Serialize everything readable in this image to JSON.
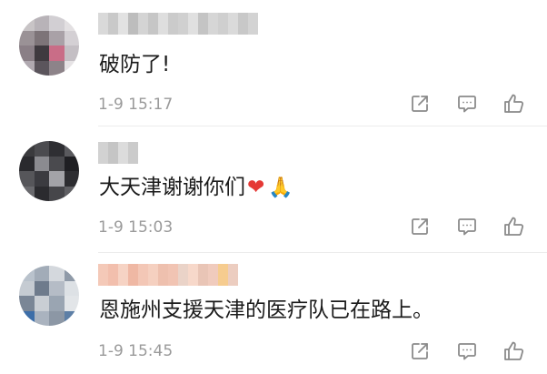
{
  "comments": [
    {
      "text": "破防了!",
      "time": "1-9 15:17",
      "avatar_pixels": [
        "#c8c4c6",
        "#b8b3b8",
        "#d2cfd3",
        "#e3e0e2",
        "#9a9296",
        "#7d7478",
        "#a9a1a7",
        "#d4d0d4",
        "#8a7f86",
        "#3f3a3f",
        "#c96d87",
        "#c4bfc4",
        "#b0a9b0",
        "#5b555c",
        "#8d8389",
        "#e6e3e5"
      ],
      "username_blocks": [
        "#d9d9d9",
        "#c9c9c9",
        "#e2e2e2",
        "#bdbdbd",
        "#d4d4d4",
        "#c6c6c6",
        "#dedede",
        "#cbcbcb",
        "#d0d0d0",
        "#e0e0e0",
        "#c4c4c4",
        "#d6d6d6",
        "#cfcfcf",
        "#dadada",
        "#c8c8c8",
        "#d3d3d3"
      ]
    },
    {
      "text": "大天津谢谢你们",
      "time": "1-9 15:03",
      "emoji_heart": "❤",
      "emoji_hands": "🙏",
      "avatar_pixels": [
        "#3a3a3d",
        "#4b4b4f",
        "#2f2f33",
        "#5a5a5e",
        "#2a2a2e",
        "#8b8b90",
        "#4a4a4e",
        "#1f1f23",
        "#56565a",
        "#3b3b40",
        "#a3a3a8",
        "#2d2d31",
        "#6a6a6e",
        "#2b2b2f",
        "#46464a",
        "#5f5f63"
      ],
      "username_blocks": [
        "#d2d2d2",
        "#c5c5c5",
        "#dcdcdc",
        "#cbcbcb"
      ]
    },
    {
      "text": "恩施州支援天津的医疗队已在路上。",
      "time": "1-9 15:45",
      "avatar_pixels": [
        "#b9c2cc",
        "#a2acb8",
        "#d4d8dd",
        "#8f9aa8",
        "#c5cbd2",
        "#6e7b8c",
        "#b5bcc6",
        "#dde1e5",
        "#7a8696",
        "#c9ced4",
        "#9aa5b2",
        "#e2e5e8",
        "#3d6ea8",
        "#aab3bf",
        "#8c97a5",
        "#5d7fa6"
      ],
      "username_blocks": [
        "#f4c9b8",
        "#f2bfad",
        "#f6d3c4",
        "#efb8a4",
        "#f3c7b6",
        "#f5d0c0",
        "#eec0ae",
        "#f1c4b3",
        "#ead3c8",
        "#f7d8ca",
        "#e9c5b6",
        "#f0cbbd",
        "#f6cc8f",
        "#eccdc0"
      ]
    }
  ],
  "icons": {
    "share": "share-icon",
    "comment": "comment-icon",
    "like": "like-icon"
  },
  "colors": {
    "icon_stroke": "#8a8a8a",
    "time_text": "#9a9a9a",
    "content_text": "#1b1b1b"
  }
}
